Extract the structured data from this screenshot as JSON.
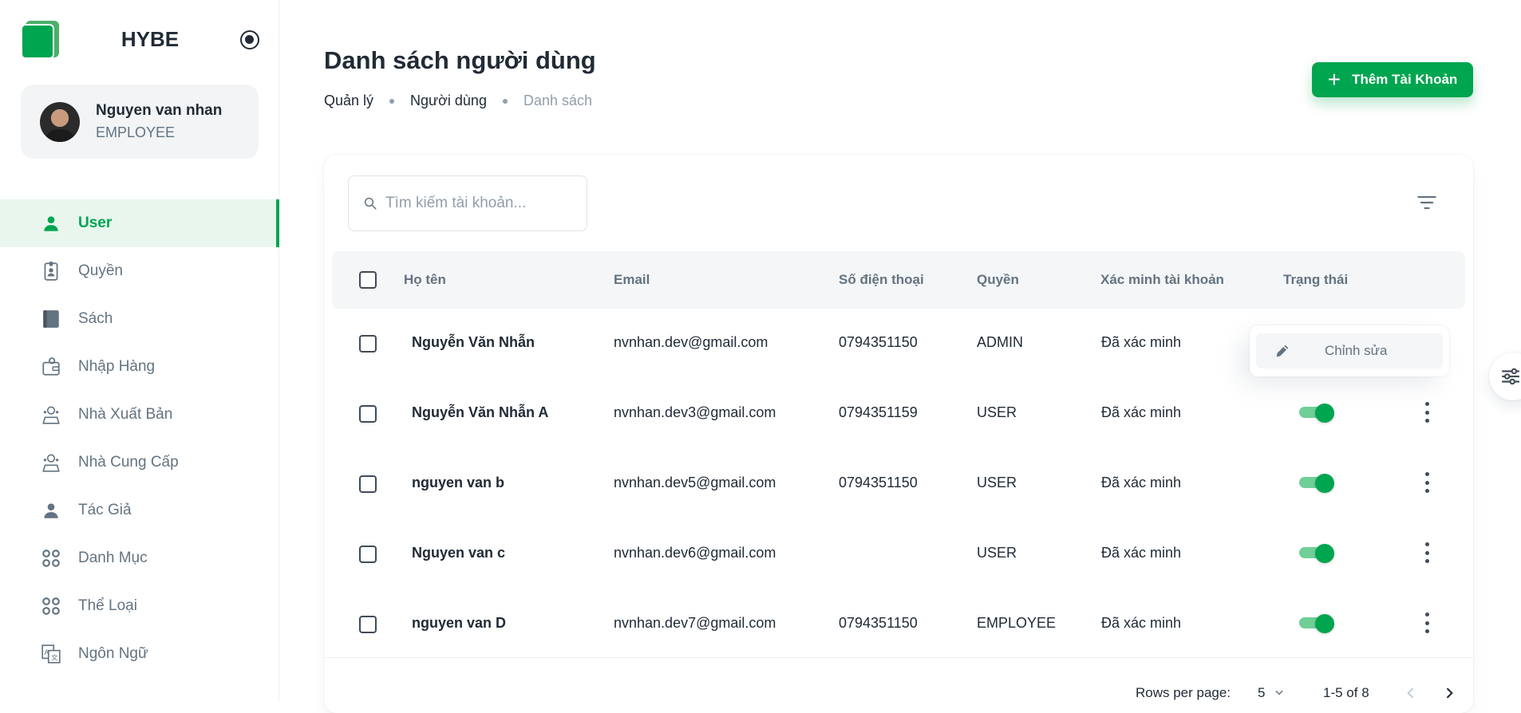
{
  "app": {
    "brand": "HYBE"
  },
  "account": {
    "name": "Nguyen van nhan",
    "role": "EMPLOYEE"
  },
  "sidebar": {
    "items": [
      {
        "label": "User",
        "icon": "user-icon",
        "active": true
      },
      {
        "label": "Quyền",
        "icon": "id-badge-icon",
        "active": false
      },
      {
        "label": "Sách",
        "icon": "book-icon",
        "active": false
      },
      {
        "label": "Nhập Hàng",
        "icon": "wallet-icon",
        "active": false
      },
      {
        "label": "Nhà Xuất Bản",
        "icon": "publisher-icon",
        "active": false
      },
      {
        "label": "Nhà Cung Cấp",
        "icon": "supplier-icon",
        "active": false
      },
      {
        "label": "Tác Giả",
        "icon": "author-icon",
        "active": false
      },
      {
        "label": "Danh Mục",
        "icon": "category-icon",
        "active": false
      },
      {
        "label": "Thể Loại",
        "icon": "genre-icon",
        "active": false
      },
      {
        "label": "Ngôn Ngữ",
        "icon": "translate-icon",
        "active": false
      }
    ]
  },
  "header": {
    "title": "Danh sách người dùng",
    "breadcrumb": [
      "Quản lý",
      "Người dùng",
      "Danh sách"
    ],
    "add_button": "Thêm Tài Khoản"
  },
  "search": {
    "placeholder": "Tìm kiếm tài khoản..."
  },
  "table": {
    "columns": [
      "Họ tên",
      "Email",
      "Số điện thoại",
      "Quyền",
      "Xác minh tài khoản",
      "Trạng thái"
    ],
    "rows": [
      {
        "name": "Nguyễn Văn Nhẫn",
        "email": "nvnhan.dev@gmail.com",
        "phone": "0794351150",
        "role": "ADMIN",
        "verified": "Đã xác minh",
        "active": true
      },
      {
        "name": "Nguyễn Văn Nhẫn A",
        "email": "nvnhan.dev3@gmail.com",
        "phone": "0794351159",
        "role": "USER",
        "verified": "Đã xác minh",
        "active": true
      },
      {
        "name": "nguyen van b",
        "email": "nvnhan.dev5@gmail.com",
        "phone": "0794351150",
        "role": "USER",
        "verified": "Đã xác minh",
        "active": true
      },
      {
        "name": "Nguyen van c",
        "email": "nvnhan.dev6@gmail.com",
        "phone": "",
        "role": "USER",
        "verified": "Đã xác minh",
        "active": true
      },
      {
        "name": "nguyen van D",
        "email": "nvnhan.dev7@gmail.com",
        "phone": "0794351150",
        "role": "EMPLOYEE",
        "verified": "Đã xác minh",
        "active": true
      }
    ]
  },
  "pagination": {
    "rows_per_page_label": "Rows per page:",
    "rows_per_page": "5",
    "range": "1-5 of 8"
  },
  "popover": {
    "edit_label": "Chỉnh sửa"
  },
  "colors": {
    "accent": "#00a550",
    "text": "#212b36",
    "muted": "#637381"
  }
}
